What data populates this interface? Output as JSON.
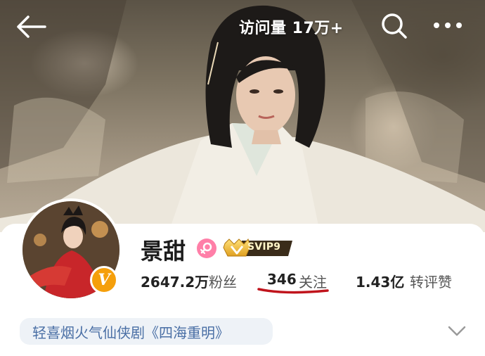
{
  "header": {
    "visits_text": "访问量 17万+"
  },
  "profile": {
    "name": "景甜",
    "vip_label": "SVIP9",
    "verified_badge": "V",
    "accent_color": "#f59f0b",
    "gender_color": "#ff7fa8"
  },
  "stats": {
    "followers_count": "2647.2万",
    "followers_label": "粉丝",
    "following_count": "346",
    "following_label": "关注",
    "interactions_count": "1.43亿",
    "interactions_label": "转评赞"
  },
  "tag": {
    "text": "轻喜烟火气仙侠剧《四海重明》"
  },
  "icons": {
    "back": "back-arrow-icon",
    "search": "search-icon",
    "more": "more-icon",
    "expand": "chevron-down-icon",
    "gender": "female-icon"
  }
}
